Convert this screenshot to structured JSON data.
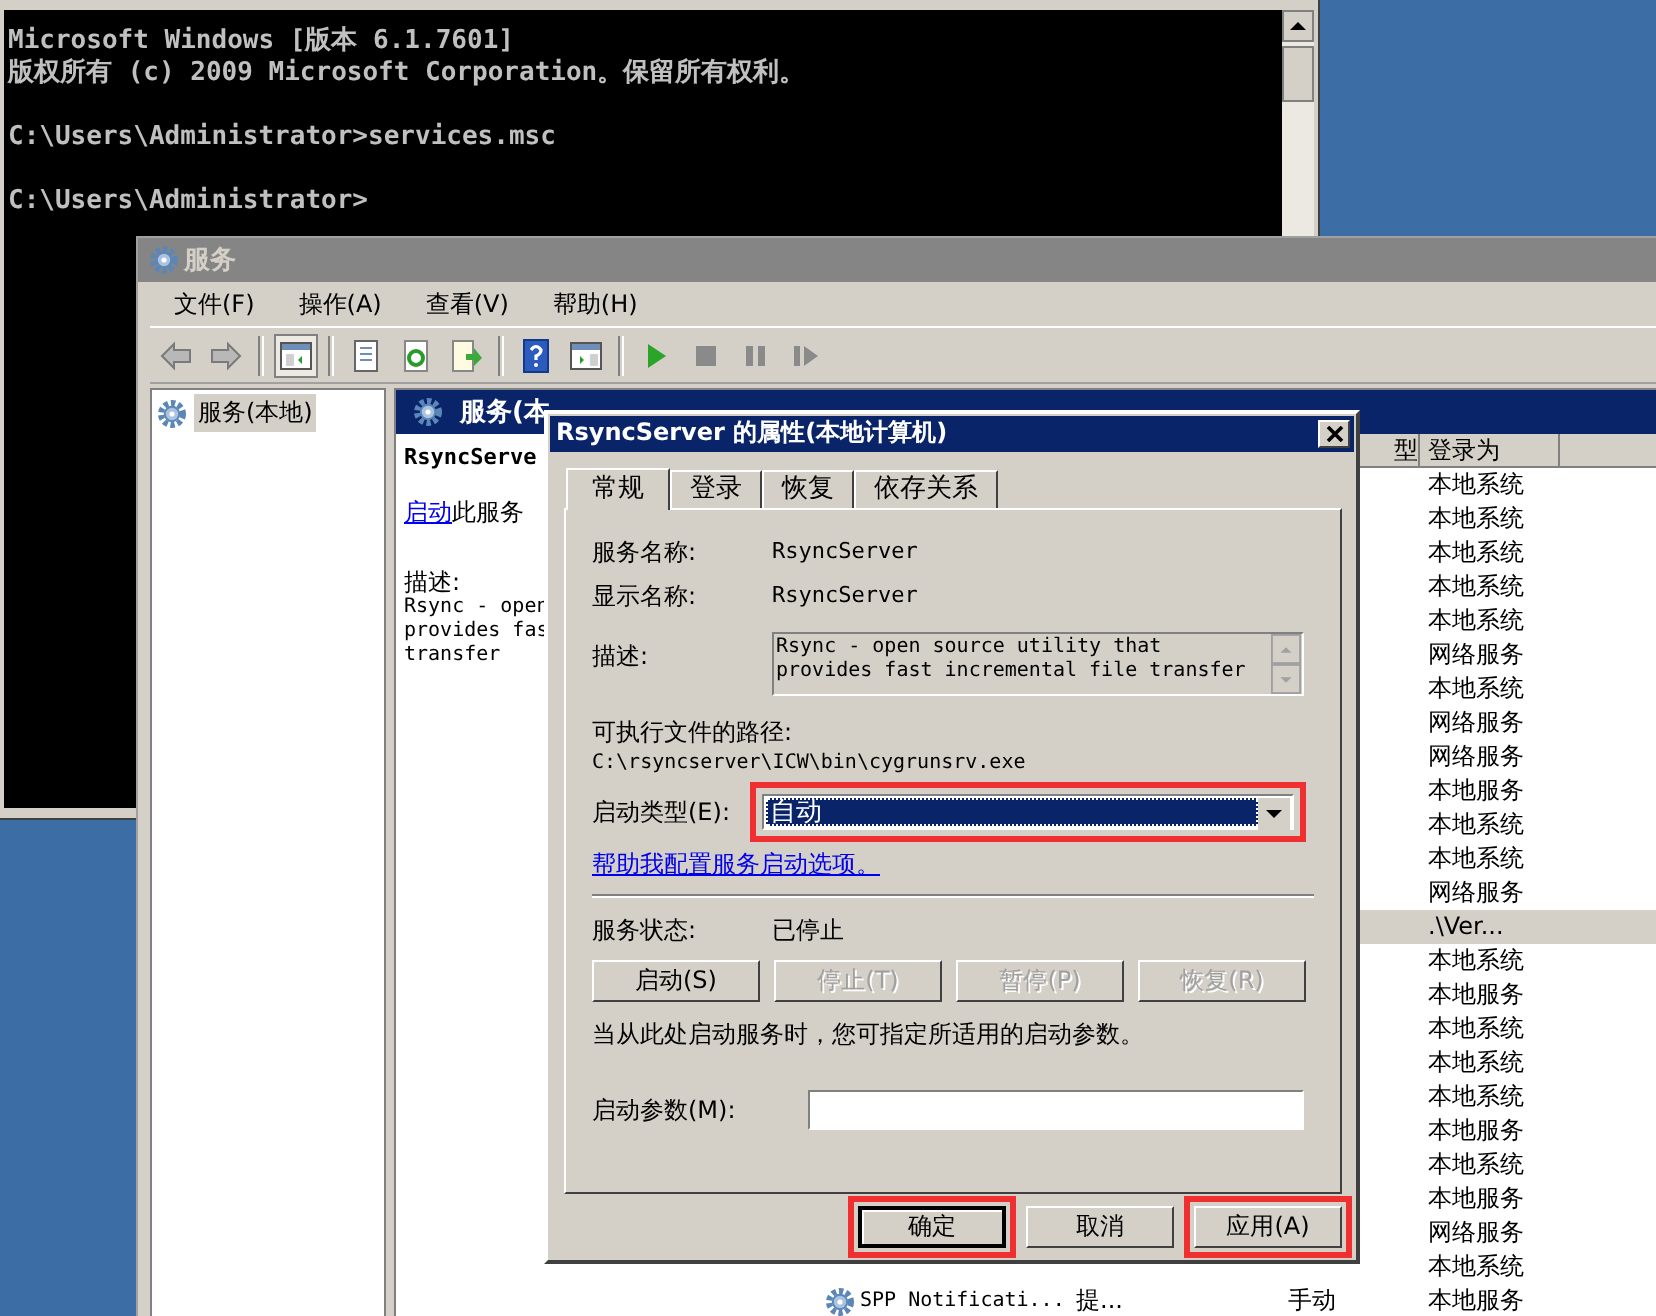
{
  "cmd_window": {
    "output": "Microsoft Windows [版本 6.1.7601]\n版权所有 (c) 2009 Microsoft Corporation。保留所有权利。\n\nC:\\Users\\Administrator>services.msc\n\nC:\\Users\\Administrator>"
  },
  "services_window": {
    "title": "服务",
    "menu": [
      "文件(F)",
      "操作(A)",
      "查看(V)",
      "帮助(H)"
    ],
    "tree": [
      {
        "label": "服务(本地)",
        "selected": true
      }
    ],
    "pane_title": "服务(本",
    "detail": {
      "service_name": "RsyncServe",
      "action_link": "启动",
      "action_text": "此服务",
      "description_label": "描述:",
      "description_lines": [
        "Rsync - open",
        "provides fas",
        "transfer"
      ]
    },
    "columns": [
      {
        "label": "型"
      },
      {
        "label": "登录为"
      }
    ],
    "rows": [
      {
        "logon": "本地系统",
        "selected": false
      },
      {
        "logon": "本地系统",
        "selected": false
      },
      {
        "logon": "本地系统",
        "selected": false
      },
      {
        "logon": "本地系统",
        "selected": false
      },
      {
        "logon": "本地系统",
        "selected": false
      },
      {
        "logon": "网络服务",
        "selected": false
      },
      {
        "logon": "本地系统",
        "selected": false
      },
      {
        "logon": "网络服务",
        "selected": false
      },
      {
        "logon": "网络服务",
        "selected": false
      },
      {
        "logon": "本地服务",
        "selected": false
      },
      {
        "logon": "本地系统",
        "selected": false
      },
      {
        "logon": "本地系统",
        "selected": false
      },
      {
        "logon": "网络服务",
        "selected": false
      },
      {
        "logon": ".\\Ver...",
        "selected": true
      },
      {
        "logon": "本地系统",
        "selected": false
      },
      {
        "logon": "本地服务",
        "selected": false
      },
      {
        "logon": "本地系统",
        "selected": false
      },
      {
        "logon": "本地系统",
        "selected": false
      },
      {
        "logon": "本地系统",
        "selected": false
      },
      {
        "logon": "本地服务",
        "selected": false
      },
      {
        "logon": "本地系统",
        "selected": false
      },
      {
        "logon": "本地服务",
        "selected": false
      },
      {
        "logon": "网络服务",
        "selected": false
      },
      {
        "logon": "本地系统",
        "selected": false
      },
      {
        "name": "SPP Notificati...",
        "description": "提...",
        "startup": "手动",
        "logon": "本地服务",
        "selected": false
      }
    ]
  },
  "dialog": {
    "title": "RsyncServer 的属性(本地计算机)",
    "tabs": [
      {
        "label": "常规",
        "selected": true
      },
      {
        "label": "登录",
        "selected": false
      },
      {
        "label": "恢复",
        "selected": false
      },
      {
        "label": "依存关系",
        "selected": false
      }
    ],
    "fields": [
      {
        "label": "服务名称:",
        "value": "RsyncServer"
      },
      {
        "label": "显示名称:",
        "value": "RsyncServer"
      }
    ],
    "description": {
      "label": "描述:",
      "value": "Rsync - open source utility that provides fast incremental file transfer"
    },
    "path": {
      "label": "可执行文件的路径:",
      "value": "C:\\rsyncserver\\ICW\\bin\\cygrunsrv.exe"
    },
    "startup_type": {
      "label": "启动类型(E):",
      "value": "自动",
      "focused": true,
      "highlighted": true
    },
    "help_link": "帮助我配置服务启动选项。",
    "status": {
      "label": "服务状态:",
      "value": "已停止"
    },
    "control_buttons": [
      {
        "label": "启动(S)",
        "disabled": false
      },
      {
        "label": "停止(T)",
        "disabled": true
      },
      {
        "label": "暂停(P)",
        "disabled": true
      },
      {
        "label": "恢复(R)",
        "disabled": true
      }
    ],
    "hint": "当从此处启动服务时，您可指定所适用的启动参数。",
    "parameters": {
      "label": "启动参数(M):"
    },
    "buttons": [
      {
        "label": "确定",
        "default": true,
        "highlighted": true
      },
      {
        "label": "取消",
        "default": false,
        "highlighted": false
      },
      {
        "label": "应用(A)",
        "default": false,
        "highlighted": true
      }
    ]
  }
}
